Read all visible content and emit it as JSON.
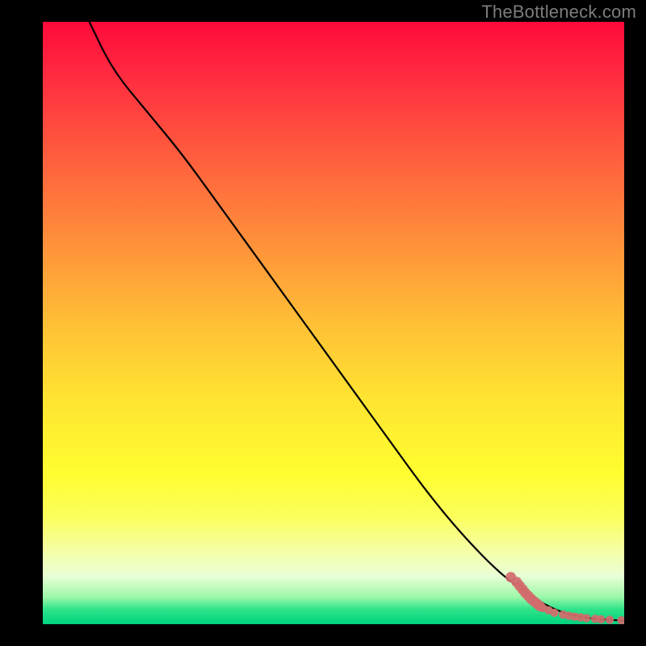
{
  "watermark": "TheBottleneck.com",
  "colors": {
    "background": "#000000",
    "curve": "#000000",
    "marker_fill": "#d16b6b",
    "marker_stroke": "#b84f4f",
    "gradient_top": "#ff0a3a",
    "gradient_mid": "#ffe531",
    "gradient_bottom": "#00d37e"
  },
  "chart_data": {
    "type": "line",
    "title": "",
    "xlabel": "",
    "ylabel": "",
    "xlim": [
      0,
      100
    ],
    "ylim": [
      0,
      100
    ],
    "grid": false,
    "series": [
      {
        "name": "bottleneck-curve",
        "x": [
          8,
          12,
          18,
          24,
          30,
          36,
          42,
          48,
          54,
          60,
          66,
          72,
          78,
          82,
          85,
          88,
          90,
          92,
          94,
          96,
          98,
          100
        ],
        "y": [
          100,
          92,
          85,
          78,
          70,
          62,
          54,
          46,
          38,
          30,
          22,
          15,
          9,
          6,
          4,
          2.5,
          1.8,
          1.3,
          1.0,
          0.8,
          0.7,
          0.6
        ],
        "has_markers": false
      },
      {
        "name": "bottleneck-markers",
        "x": [
          80.5,
          81.5,
          82,
          82.5,
          83,
          83.5,
          84,
          84.5,
          85,
          85.5,
          86,
          87,
          88,
          89.5,
          90.5,
          91.5,
          92.5,
          93.5,
          95,
          96,
          97.5,
          99.5
        ],
        "y": [
          7.8,
          7.0,
          6.4,
          5.8,
          5.2,
          4.7,
          4.2,
          3.8,
          3.4,
          3.0,
          2.7,
          2.3,
          1.9,
          1.6,
          1.4,
          1.25,
          1.12,
          1.02,
          0.9,
          0.82,
          0.74,
          0.65
        ],
        "has_markers": true
      }
    ]
  }
}
